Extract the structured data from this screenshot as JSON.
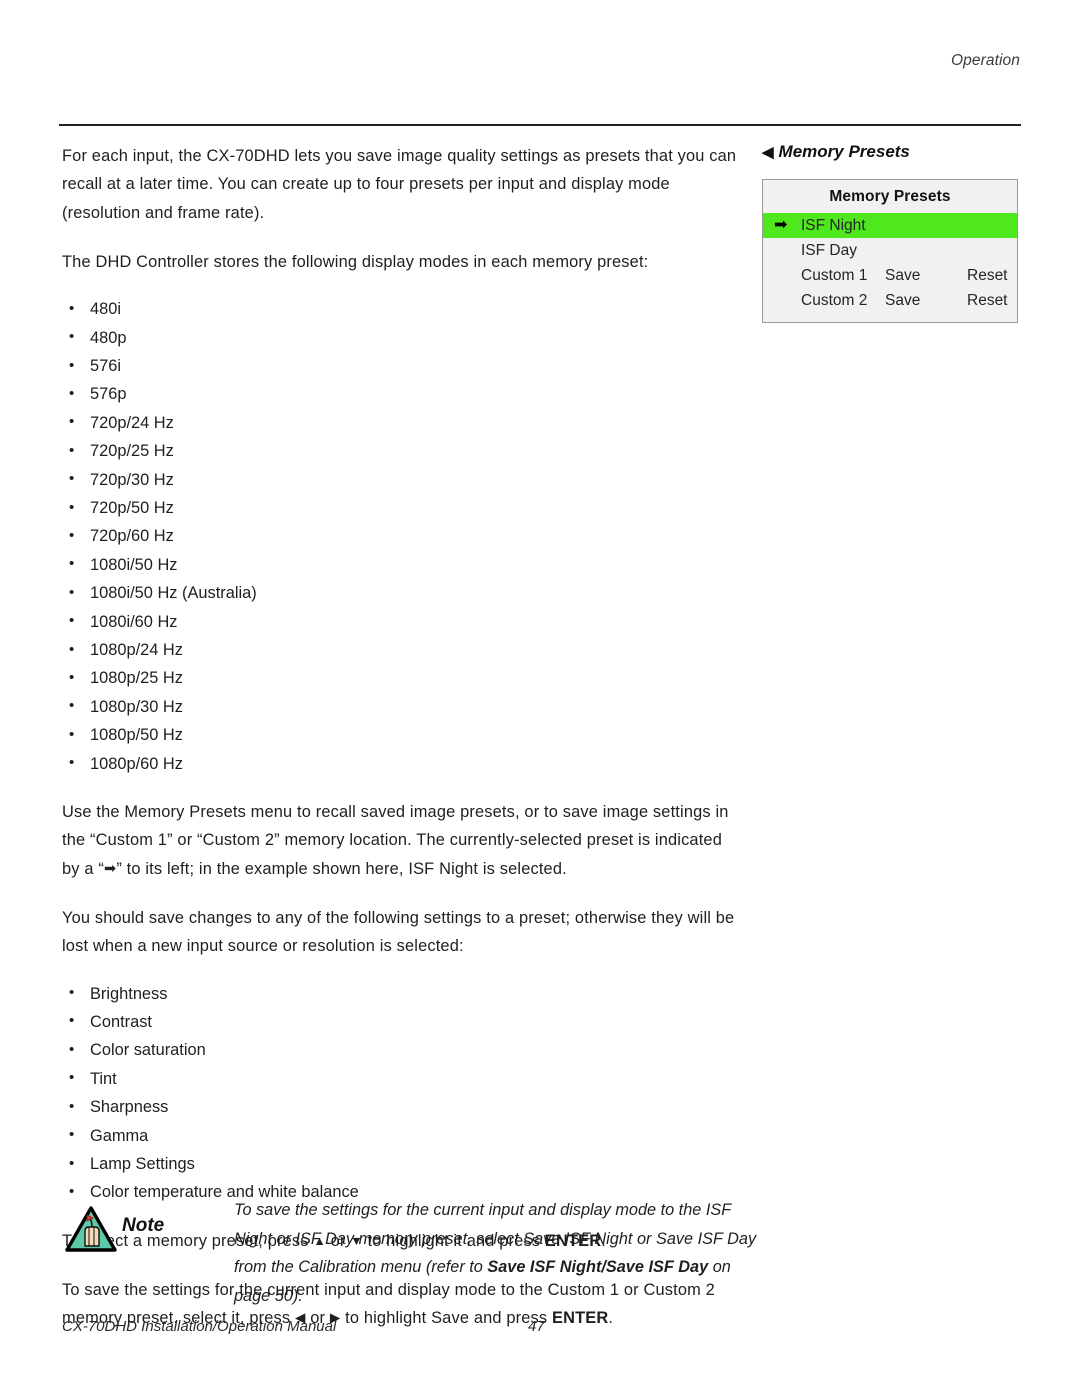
{
  "running_head": "Operation",
  "body": {
    "p1": "For each input, the CX-70DHD lets you save image quality settings as presets that you can recall at a later time. You can create up to four presets per input and display mode (resolution and frame rate).",
    "p2": "The DHD Controller stores the following display modes in each memory preset:",
    "display_modes": [
      "480i",
      "480p",
      "576i",
      "576p",
      "720p/24 Hz",
      "720p/25 Hz",
      "720p/30 Hz",
      "720p/50 Hz",
      "720p/60 Hz",
      "1080i/50 Hz",
      "1080i/50 Hz (Australia)",
      "1080i/60 Hz",
      "1080p/24 Hz",
      "1080p/25 Hz",
      "1080p/30 Hz",
      "1080p/50 Hz",
      "1080p/60 Hz"
    ],
    "p3_a": "Use the Memory Presets menu to recall saved image presets, or to save image settings in the “Custom 1” or “Custom 2” memory location. The currently-selected preset is indicated by a “",
    "p3_b": "” to its left; in the example shown here, ISF Night is selected.",
    "p4": "You should save changes to any of the following settings to a preset; otherwise they will be lost when a new input source or resolution is selected:",
    "settings": [
      "Brightness",
      "Contrast",
      "Color saturation",
      "Tint",
      "Sharpness",
      "Gamma",
      "Lamp Settings",
      "Color temperature and white balance"
    ],
    "p5_a": "To select a memory preset, press ",
    "p5_b": " or ",
    "p5_c": " to highlight it and press ",
    "p5_enter": "ENTER",
    "p5_d": ".",
    "p6_a": "To save the settings for the current input and display mode to the Custom 1 or Custom 2 memory preset, select it, press ",
    "p6_b": " or ",
    "p6_c": " to highlight Save and press ",
    "p6_enter": "ENTER",
    "p6_d": "."
  },
  "osd": {
    "caption": "Memory Presets",
    "caption_caret": "◀",
    "title": "Memory Presets",
    "selection_marker": "➡",
    "highlight_color": "#4fe81e",
    "background_color": "#f1f1f1",
    "border_color": "#9a9a9a",
    "rows": [
      {
        "name": "ISF Night",
        "save": "",
        "reset": "",
        "selected": true
      },
      {
        "name": "ISF Day",
        "save": "",
        "reset": "",
        "selected": false
      },
      {
        "name": "Custom 1",
        "save": "Save",
        "reset": "Reset",
        "selected": false
      },
      {
        "name": "Custom 2",
        "save": "Save",
        "reset": "Reset",
        "selected": false
      }
    ]
  },
  "note": {
    "label": "Note",
    "text_a": "To save the settings for the current input and display mode to the ISF Night or ISF Day memory preset, select Save ISF Night or Save ISF Day from the Calibration menu (refer to ",
    "text_bold": "Save ISF Night/Save ISF Day",
    "text_b": " on page 50)."
  },
  "footer": {
    "manual_title": "CX-70DHD Installation/Operation Manual",
    "page_number": "47"
  }
}
